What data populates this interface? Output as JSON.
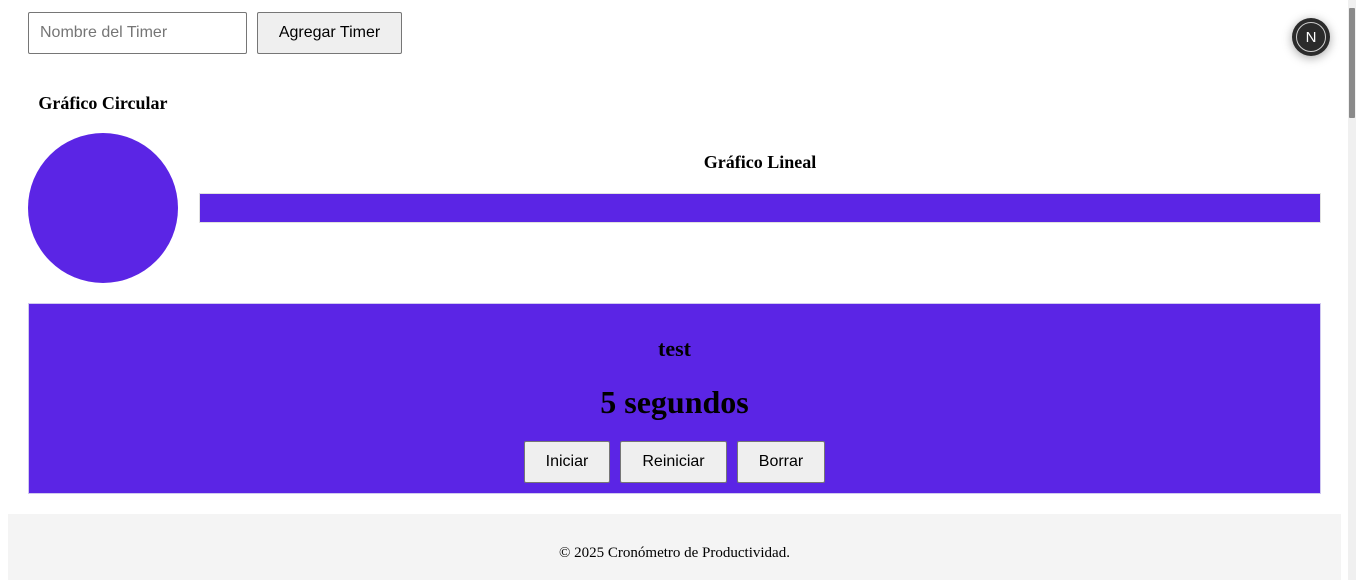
{
  "form": {
    "timer_name_placeholder": "Nombre del Timer",
    "timer_name_value": "",
    "add_button_label": "Agregar Timer"
  },
  "dev_badge": {
    "letter": "N"
  },
  "pie_chart": {
    "title": "Gráfico Circular"
  },
  "line_chart": {
    "title": "Gráfico Lineal"
  },
  "chart_data": [
    {
      "type": "pie",
      "title": "Gráfico Circular",
      "categories": [
        "test"
      ],
      "values": [
        5
      ],
      "colors": [
        "#5b25e5"
      ]
    },
    {
      "type": "bar",
      "title": "Gráfico Lineal",
      "categories": [
        "test"
      ],
      "values": [
        5
      ],
      "colors": [
        "#5b25e5"
      ]
    }
  ],
  "timers": [
    {
      "name": "test",
      "time_text": "5 segundos",
      "color": "#5b25e5",
      "start_label": "Iniciar",
      "reset_label": "Reiniciar",
      "delete_label": "Borrar"
    }
  ],
  "footer": {
    "text": "© 2025 Cronómetro de Productividad."
  },
  "colors": {
    "accent": "#5b25e5",
    "footer_bg": "#f4f4f4",
    "button_bg": "#efefef"
  }
}
